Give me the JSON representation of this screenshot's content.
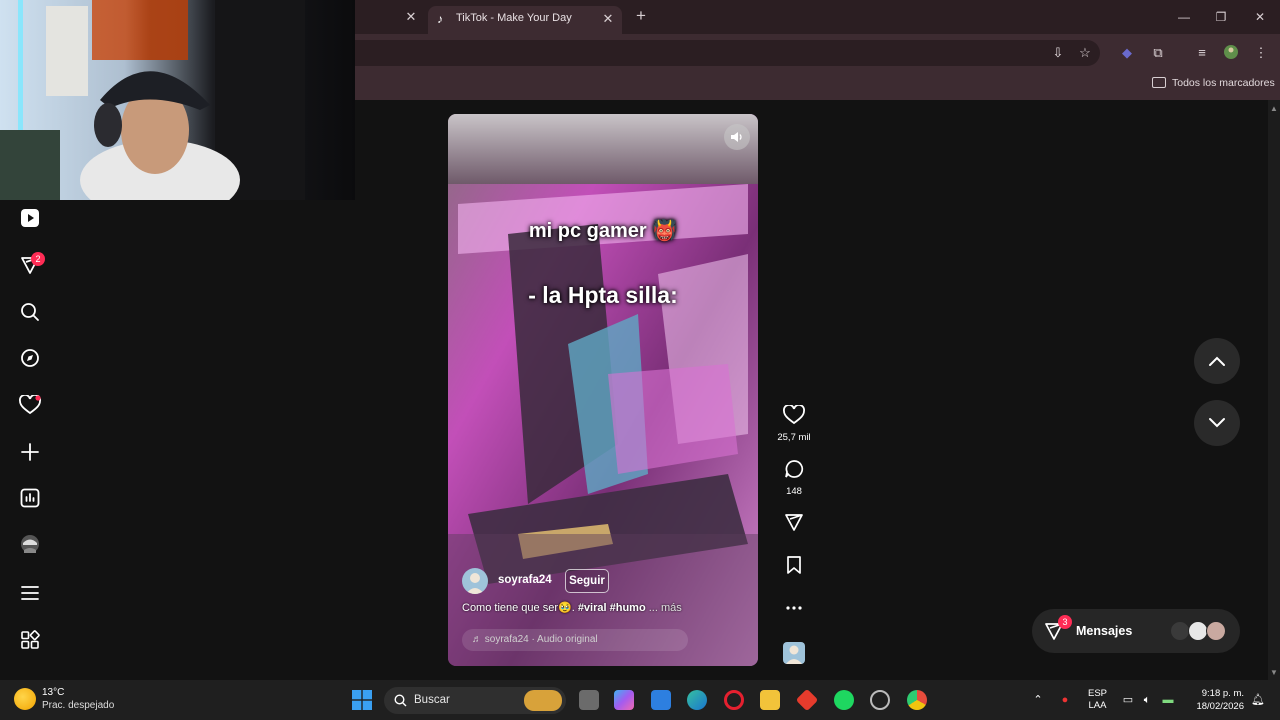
{
  "browser": {
    "tab_title": "TikTok - Make Your Day",
    "bookmarks_label": "Todos los marcadores"
  },
  "sidebar": {
    "items": [
      {
        "name": "for-you-icon"
      },
      {
        "name": "inbox-icon",
        "badge": "2"
      },
      {
        "name": "search-icon"
      },
      {
        "name": "explore-icon"
      },
      {
        "name": "following-icon"
      },
      {
        "name": "upload-icon"
      },
      {
        "name": "analytics-icon"
      },
      {
        "name": "profile-icon"
      },
      {
        "name": "menu-icon"
      },
      {
        "name": "more-apps-icon"
      }
    ]
  },
  "video": {
    "overlay_line1": "mi pc gamer 👹",
    "overlay_line2": "- la Hpta silla:",
    "author": "soyrafa24",
    "follow_label": "Seguir",
    "description_text": "Como tiene que ser🥹. ",
    "hashtag1": "#viral",
    "hashtag2": "#humo",
    "more_label": "... más",
    "music": "♬ soyrafa24 · Audio original"
  },
  "actions": {
    "likes": "25,7 mil",
    "comments": "148"
  },
  "messages": {
    "label": "Mensajes",
    "badge": "3"
  },
  "taskbar": {
    "temperature": "13°C",
    "condition": "Prac. despejado",
    "search_label": "Buscar",
    "lang_line1": "ESP",
    "lang_line2": "LAA",
    "time": "9:18 p. m.",
    "date": "18/02/2026"
  },
  "colors": {
    "accent": "#fe2c55",
    "browser_frame": "#2b1e22",
    "toolbar": "#3d2b31",
    "page_bg": "#121212"
  }
}
